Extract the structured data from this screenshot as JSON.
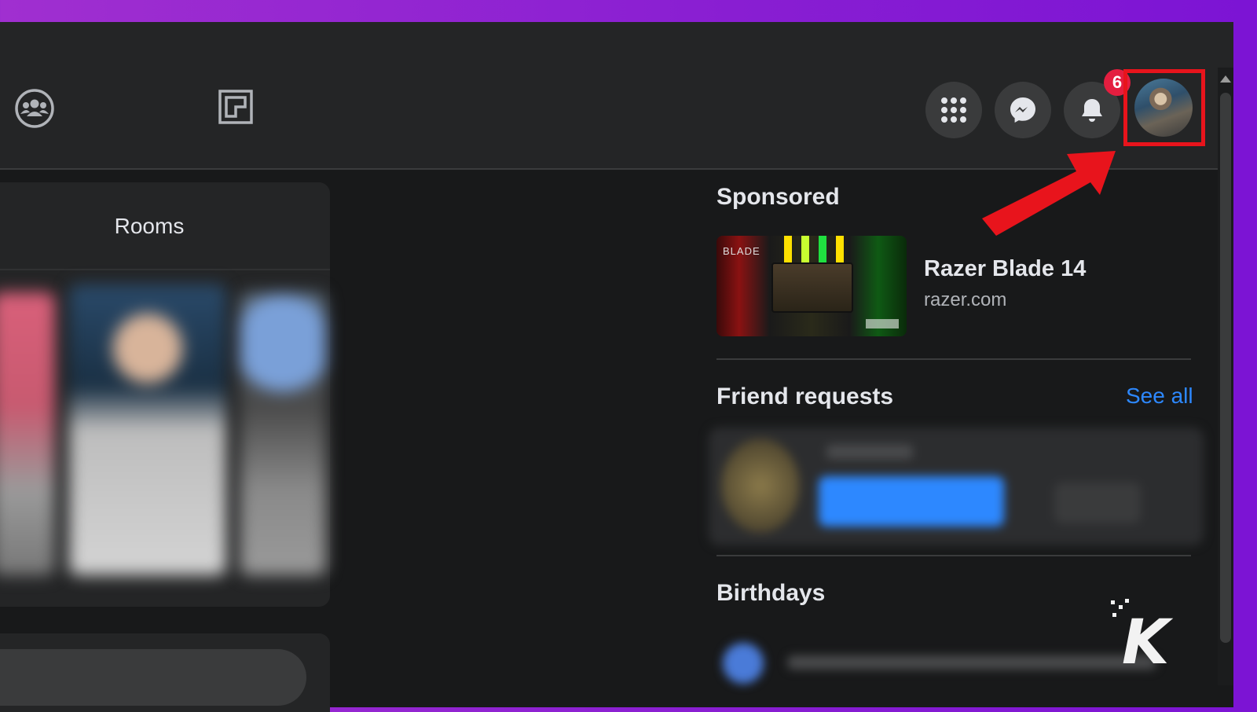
{
  "colors": {
    "background_gradient_start": "#a02fd0",
    "background_gradient_end": "#7c14d4",
    "window_bg": "#18191a",
    "panel_bg": "#242526",
    "accent_link": "#2d88ff",
    "notification_badge": "#e41e3f",
    "highlight_red": "#e8141c"
  },
  "navbar": {
    "icons": [
      "groups-icon",
      "gaming-icon",
      "menu-grid-icon",
      "messenger-icon",
      "notifications-bell-icon",
      "profile-avatar"
    ],
    "notification_count": "6"
  },
  "rooms": {
    "title": "Rooms"
  },
  "sponsored": {
    "title": "Sponsored",
    "ad": {
      "image_text": "BLADE",
      "name": "Razer Blade 14",
      "domain": "razer.com"
    }
  },
  "friend_requests": {
    "title": "Friend requests",
    "see_all": "See all"
  },
  "birthdays": {
    "title": "Birthdays"
  },
  "watermark": {
    "letter": "K"
  }
}
